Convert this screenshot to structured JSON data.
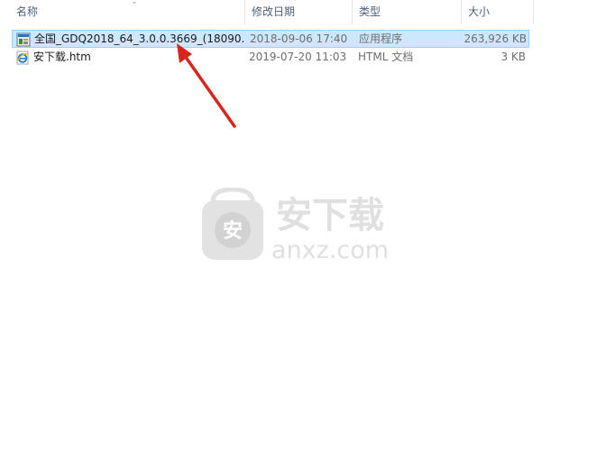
{
  "columns": {
    "name": "名称",
    "modified": "修改日期",
    "type": "类型",
    "size": "大小"
  },
  "files": [
    {
      "name": "全国_GDQ2018_64_3.0.0.3669_(18090...",
      "modified": "2018-09-06 17:40",
      "type": "应用程序",
      "size": "263,926 KB",
      "icon": "exe-installer-icon",
      "selected": true
    },
    {
      "name": "安下载.htm",
      "modified": "2019-07-20 11:03",
      "type": "HTML 文档",
      "size": "3 KB",
      "icon": "ie-html-icon",
      "selected": false
    }
  ],
  "watermark": {
    "title": "安下载",
    "domain": "anxz.com",
    "badge": "安"
  },
  "colors": {
    "selection": "#cce8ff",
    "selection_border": "#99d1ff",
    "header_text": "#4c607a",
    "annotation_arrow": "#d9251d"
  }
}
